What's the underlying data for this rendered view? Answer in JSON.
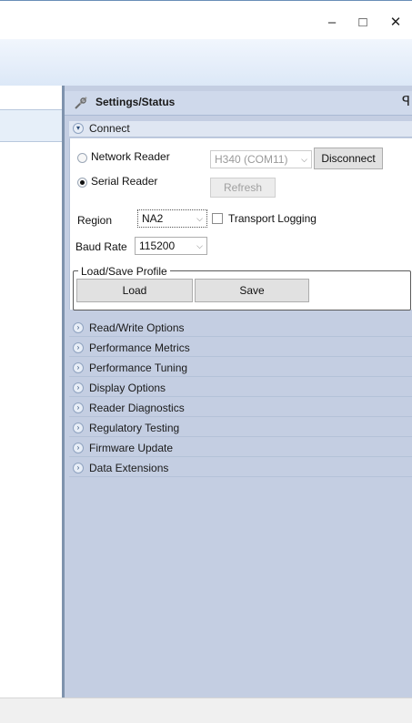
{
  "window": {
    "controls": {
      "minimize": "–",
      "maximize": "□",
      "close": "✕"
    }
  },
  "panel": {
    "title": "Settings/Status",
    "pin_glyph": "ꟼ"
  },
  "connect": {
    "section_label": "Connect",
    "network_reader_label": "Network Reader",
    "serial_reader_label": "Serial Reader",
    "selected_reader": "Serial Reader",
    "device_port": "H340 (COM11)",
    "disconnect_label": "Disconnect",
    "refresh_label": "Refresh",
    "region_label": "Region",
    "region_value": "NA2",
    "transport_logging_label": "Transport Logging",
    "transport_logging_checked": false,
    "baud_rate_label": "Baud Rate",
    "baud_rate_value": "115200",
    "profile_group_label": "Load/Save Profile",
    "load_label": "Load",
    "save_label": "Save"
  },
  "sections": [
    "Read/Write Options",
    "Performance Metrics",
    "Performance Tuning",
    "Display Options",
    "Reader Diagnostics",
    "Regulatory Testing",
    "Firmware Update",
    "Data Extensions"
  ],
  "icons": {
    "panel_icon": "wrench-screwdriver-icon",
    "expand_icon": "chevron-right-icon",
    "collapse_icon": "chevron-down-icon",
    "combo_icon": "chevron-down-icon"
  },
  "colors": {
    "pane_background": "#c4cee2",
    "header_background": "#cfd9eb",
    "ribbon": "#dce8f7",
    "divider": "#7f93ad"
  }
}
